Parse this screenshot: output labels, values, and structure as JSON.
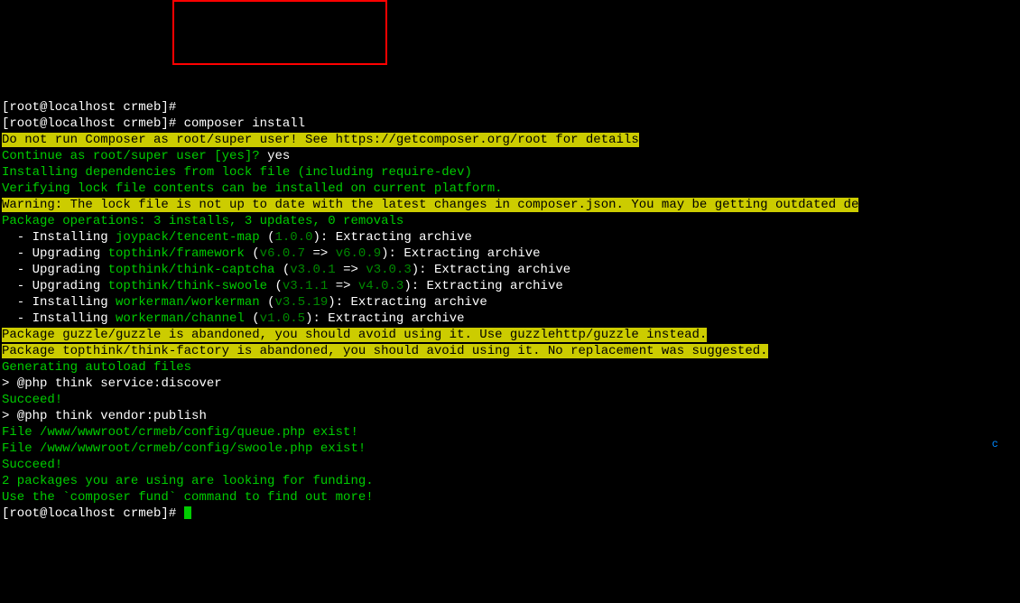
{
  "prompt1": "[root@localhost crmeb]# ",
  "prompt2": "[root@localhost crmeb]# ",
  "command": "composer install",
  "warn_root": "Do not run Composer as root/super user! See https://getcomposer.org/root for details",
  "continue_prompt": "Continue as root/super user [yes]? ",
  "continue_answer": "yes",
  "installing_deps": "Installing dependencies from lock file (including require-dev)",
  "verifying": "Verifying lock file contents can be installed on current platform.",
  "warn_lock": "Warning: The lock file is not up to date with the latest changes in composer.json. You may be getting outdated de",
  "package_ops": "Package operations: 3 installs, 3 updates, 0 removals",
  "op1_prefix": "  - Installing ",
  "op1_pkg": "joypack/tencent-map",
  "op1_ver": " (",
  "op1_ver_green": "1.0.0",
  "op1_suffix": "): Extracting archive",
  "op2_prefix": "  - Upgrading ",
  "op2_pkg": "topthink/framework",
  "op2_ver": " (",
  "op2_ver_from": "v6.0.7",
  "op2_arrow": " => ",
  "op2_ver_to": "v6.0.9",
  "op2_suffix": "): Extracting archive",
  "op3_prefix": "  - Upgrading ",
  "op3_pkg": "topthink/think-captcha",
  "op3_ver": " (",
  "op3_ver_from": "v3.0.1",
  "op3_arrow": " => ",
  "op3_ver_to": "v3.0.3",
  "op3_suffix": "): Extracting archive",
  "op4_prefix": "  - Upgrading ",
  "op4_pkg": "topthink/think-swoole",
  "op4_ver": " (",
  "op4_ver_from": "v3.1.1",
  "op4_arrow": " => ",
  "op4_ver_to": "v4.0.3",
  "op4_suffix": "): Extracting archive",
  "op5_prefix": "  - Installing ",
  "op5_pkg": "workerman/workerman",
  "op5_ver": " (",
  "op5_ver_green": "v3.5.19",
  "op5_suffix": "): Extracting archive",
  "op6_prefix": "  - Installing ",
  "op6_pkg": "workerman/channel",
  "op6_ver": " (",
  "op6_ver_green": "v1.0.5",
  "op6_suffix": "): Extracting archive",
  "abandoned1": "Package guzzle/guzzle is abandoned, you should avoid using it. Use guzzlehttp/guzzle instead.",
  "abandoned2": "Package topthink/think-factory is abandoned, you should avoid using it. No replacement was suggested.",
  "gen_autoload": "Generating autoload files",
  "script1_prefix": "> ",
  "script1": "@php think service:discover",
  "succeed1": "Succeed!",
  "script2_prefix": "> ",
  "script2": "@php think vendor:publish",
  "file1": "File /www/wwwroot/crmeb/config/queue.php exist!",
  "file2": "File /www/wwwroot/crmeb/config/swoole.php exist!",
  "succeed2": "Succeed!",
  "funding1": "2 packages you are using are looking for funding.",
  "funding2": "Use the `composer fund` command to find out more!",
  "prompt3": "[root@localhost crmeb]# ",
  "dot": "c"
}
